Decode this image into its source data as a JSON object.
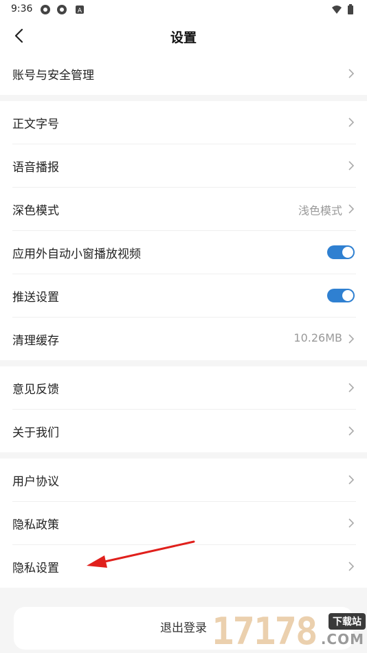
{
  "status_bar": {
    "time": "9:36",
    "icons": [
      "location-icon",
      "location-icon",
      "notification-a-icon",
      "wifi-icon",
      "battery-icon"
    ]
  },
  "header": {
    "title": "设置",
    "back_icon": "back-arrow-icon"
  },
  "groups": [
    {
      "items": [
        {
          "label": "账号与安全管理",
          "type": "chevron"
        }
      ]
    },
    {
      "items": [
        {
          "label": "正文字号",
          "type": "chevron"
        },
        {
          "label": "语音播报",
          "type": "chevron"
        },
        {
          "label": "深色模式",
          "type": "value",
          "value": "浅色模式"
        },
        {
          "label": "应用外自动小窗播放视频",
          "type": "toggle",
          "on": true
        },
        {
          "label": "推送设置",
          "type": "toggle",
          "on": true
        },
        {
          "label": "清理缓存",
          "type": "value",
          "value": "10.26MB"
        }
      ]
    },
    {
      "items": [
        {
          "label": "意见反馈",
          "type": "chevron"
        },
        {
          "label": "关于我们",
          "type": "chevron"
        }
      ]
    },
    {
      "items": [
        {
          "label": "用户协议",
          "type": "chevron"
        },
        {
          "label": "隐私政策",
          "type": "chevron"
        },
        {
          "label": "隐私设置",
          "type": "chevron"
        }
      ]
    }
  ],
  "logout": {
    "label": "退出登录"
  },
  "watermark": {
    "digits": "17178",
    "badge": "下载站",
    "domain": ".COM"
  },
  "colors": {
    "accent": "#2f80d1",
    "annotation_arrow": "#e0201c"
  }
}
